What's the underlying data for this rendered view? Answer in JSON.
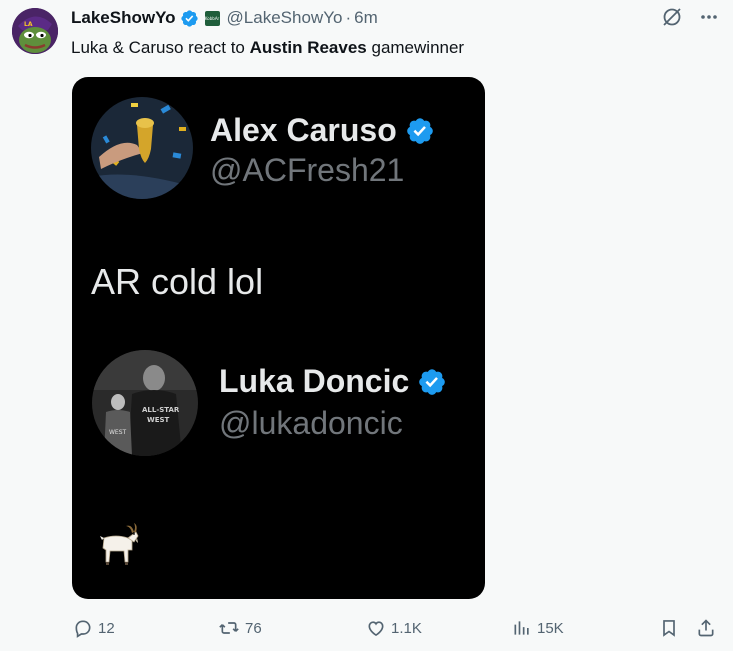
{
  "post": {
    "display_name": "LakeShowYo",
    "handle": "@LakeShowYo",
    "separator": "·",
    "time": "6m",
    "affiliate_badge_text": "KobbAr",
    "text": {
      "pre": "Luka & Caruso react to ",
      "bold": "Austin Reaves",
      "post": " gamewinner"
    }
  },
  "media": {
    "first": {
      "name": "Alex Caruso",
      "handle": "@ACFresh21",
      "text": "AR cold lol"
    },
    "second": {
      "name": "Luka Doncic",
      "handle": "@lukadoncic",
      "emoji": "goat"
    }
  },
  "actions": {
    "replies": "12",
    "reposts": "76",
    "likes": "1.1K",
    "views": "15K"
  },
  "colors": {
    "verified_blue": "#1d9bf0",
    "secondary_text": "#536471",
    "media_bg": "#000000"
  }
}
